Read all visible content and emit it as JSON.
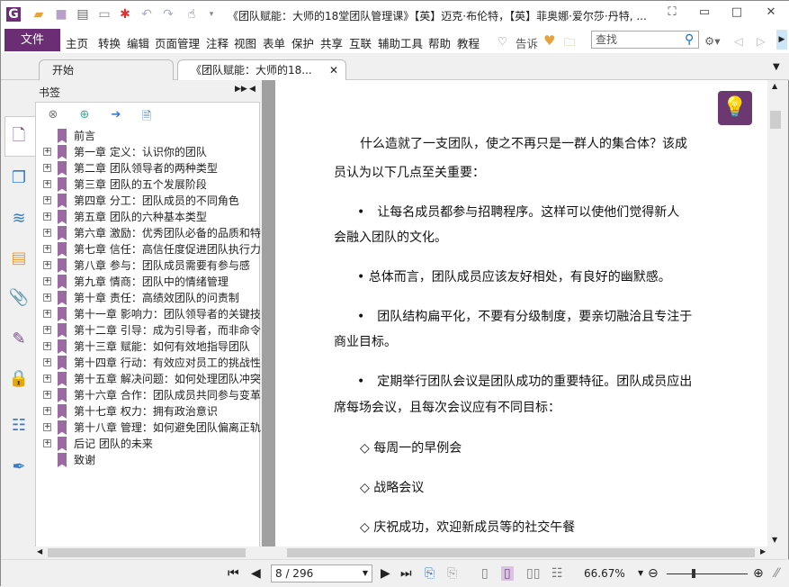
{
  "titlebar": {
    "title": "《团队赋能：大师的18堂团队管理课》【英】迈克·布伦特，【英】菲奥娜·爱尔莎·丹特, ..."
  },
  "menu": {
    "file": "文件",
    "items": [
      "主页",
      "转换",
      "编辑",
      "页面管理",
      "注释",
      "视图",
      "表单",
      "保护",
      "共享",
      "互联",
      "辅助工具",
      "帮助",
      "教程"
    ],
    "tell": "告诉",
    "search_placeholder": "查找"
  },
  "tabs": [
    {
      "label": "开始"
    },
    {
      "label": "《团队赋能：大师的18..."
    }
  ],
  "bookmarks": {
    "title": "书签",
    "items": [
      {
        "label": "前言",
        "expandable": false
      },
      {
        "label": "第一章 定义：认识你的团队",
        "expandable": true
      },
      {
        "label": "第二章 团队领导者的两种类型",
        "expandable": true
      },
      {
        "label": "第三章 团队的五个发展阶段",
        "expandable": true
      },
      {
        "label": "第四章 分工：团队成员的不同角色",
        "expandable": true
      },
      {
        "label": "第五章 团队的六种基本类型",
        "expandable": true
      },
      {
        "label": "第六章 激励：优秀团队必备的品质和特",
        "expandable": true
      },
      {
        "label": "第七章 信任：高信任度促进团队执行力",
        "expandable": true
      },
      {
        "label": "第八章 参与：团队成员需要有参与感",
        "expandable": true
      },
      {
        "label": "第九章 情商：团队中的情绪管理",
        "expandable": true
      },
      {
        "label": "第十章 责任：高绩效团队的问责制",
        "expandable": true
      },
      {
        "label": "第十一章 影响力：团队领导者的关键技",
        "expandable": true
      },
      {
        "label": "第十二章 引导：成为引导者，而非命令",
        "expandable": true
      },
      {
        "label": "第十三章 赋能：如何有效地指导团队",
        "expandable": true
      },
      {
        "label": "第十四章 行动：有效应对员工的挑战性",
        "expandable": true
      },
      {
        "label": "第十五章 解决问题：如何处理团队冲突",
        "expandable": true
      },
      {
        "label": "第十六章 合作：团队成员共同参与变革",
        "expandable": true
      },
      {
        "label": "第十七章 权力：拥有政治意识",
        "expandable": true
      },
      {
        "label": "第十八章 管理：如何避免团队偏离正轨",
        "expandable": true
      },
      {
        "label": "后记 团队的未来",
        "expandable": true
      },
      {
        "label": "致谢",
        "expandable": false
      }
    ]
  },
  "document": {
    "lines": [
      "什么造就了一支团队，使之不再只是一群人的集合体？该成",
      "员认为以下几点至关重要：",
      "•　让每名成员都参与招聘程序。这样可以使他们觉得新人",
      "会融入团队的文化。",
      "• 总体而言，团队成员应该友好相处，有良好的幽默感。",
      "•　团队结构扁平化，不要有分级制度，要亲切融洽且专注于",
      "商业目标。",
      "•　定期举行团队会议是团队成功的重要特征。团队成员应出",
      "席每场会议，且每次会议应有不同目标：",
      "◇ 每周一的早例会",
      "◇ 战略会议",
      "◇ 庆祝成功，欢迎新成员等的社交午餐"
    ]
  },
  "status": {
    "page": "8 / 296",
    "zoom": "66.67%"
  }
}
